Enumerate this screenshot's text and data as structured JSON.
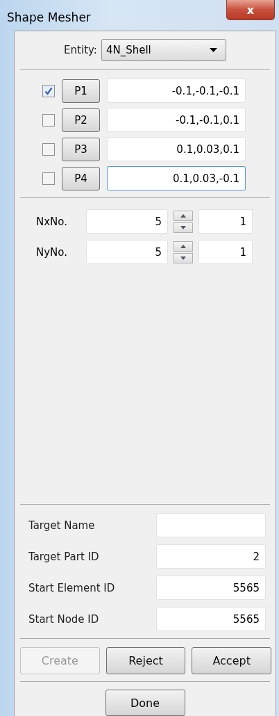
{
  "window": {
    "title": "Shape Mesher",
    "close": "x"
  },
  "entity": {
    "label": "Entity:",
    "value": "4N_Shell"
  },
  "points": [
    {
      "checked": true,
      "button": "P1",
      "value": "-0.1,-0.1,-0.1",
      "focused": false
    },
    {
      "checked": false,
      "button": "P2",
      "value": "-0.1,-0.1,0.1",
      "focused": false
    },
    {
      "checked": false,
      "button": "P3",
      "value": "0.1,0.03,0.1",
      "focused": false
    },
    {
      "checked": false,
      "button": "P4",
      "value": "0.1,0.03,-0.1",
      "focused": true
    }
  ],
  "divisions": [
    {
      "label": "NxNo.",
      "value": "5",
      "step": "1"
    },
    {
      "label": "NyNo.",
      "value": "5",
      "step": "1"
    }
  ],
  "target_fields": [
    {
      "label": "Target Name"
    },
    {
      "label": "Target Part ID",
      "value": "2"
    },
    {
      "label": "Start Element ID",
      "value": "5565"
    },
    {
      "label": "Start Node ID",
      "value": "5565"
    }
  ],
  "actions": [
    {
      "label": "Create",
      "disabled": true
    },
    {
      "label": "Reject",
      "disabled": false
    },
    {
      "label": "Accept",
      "disabled": false
    }
  ],
  "done": {
    "label": "Done"
  }
}
